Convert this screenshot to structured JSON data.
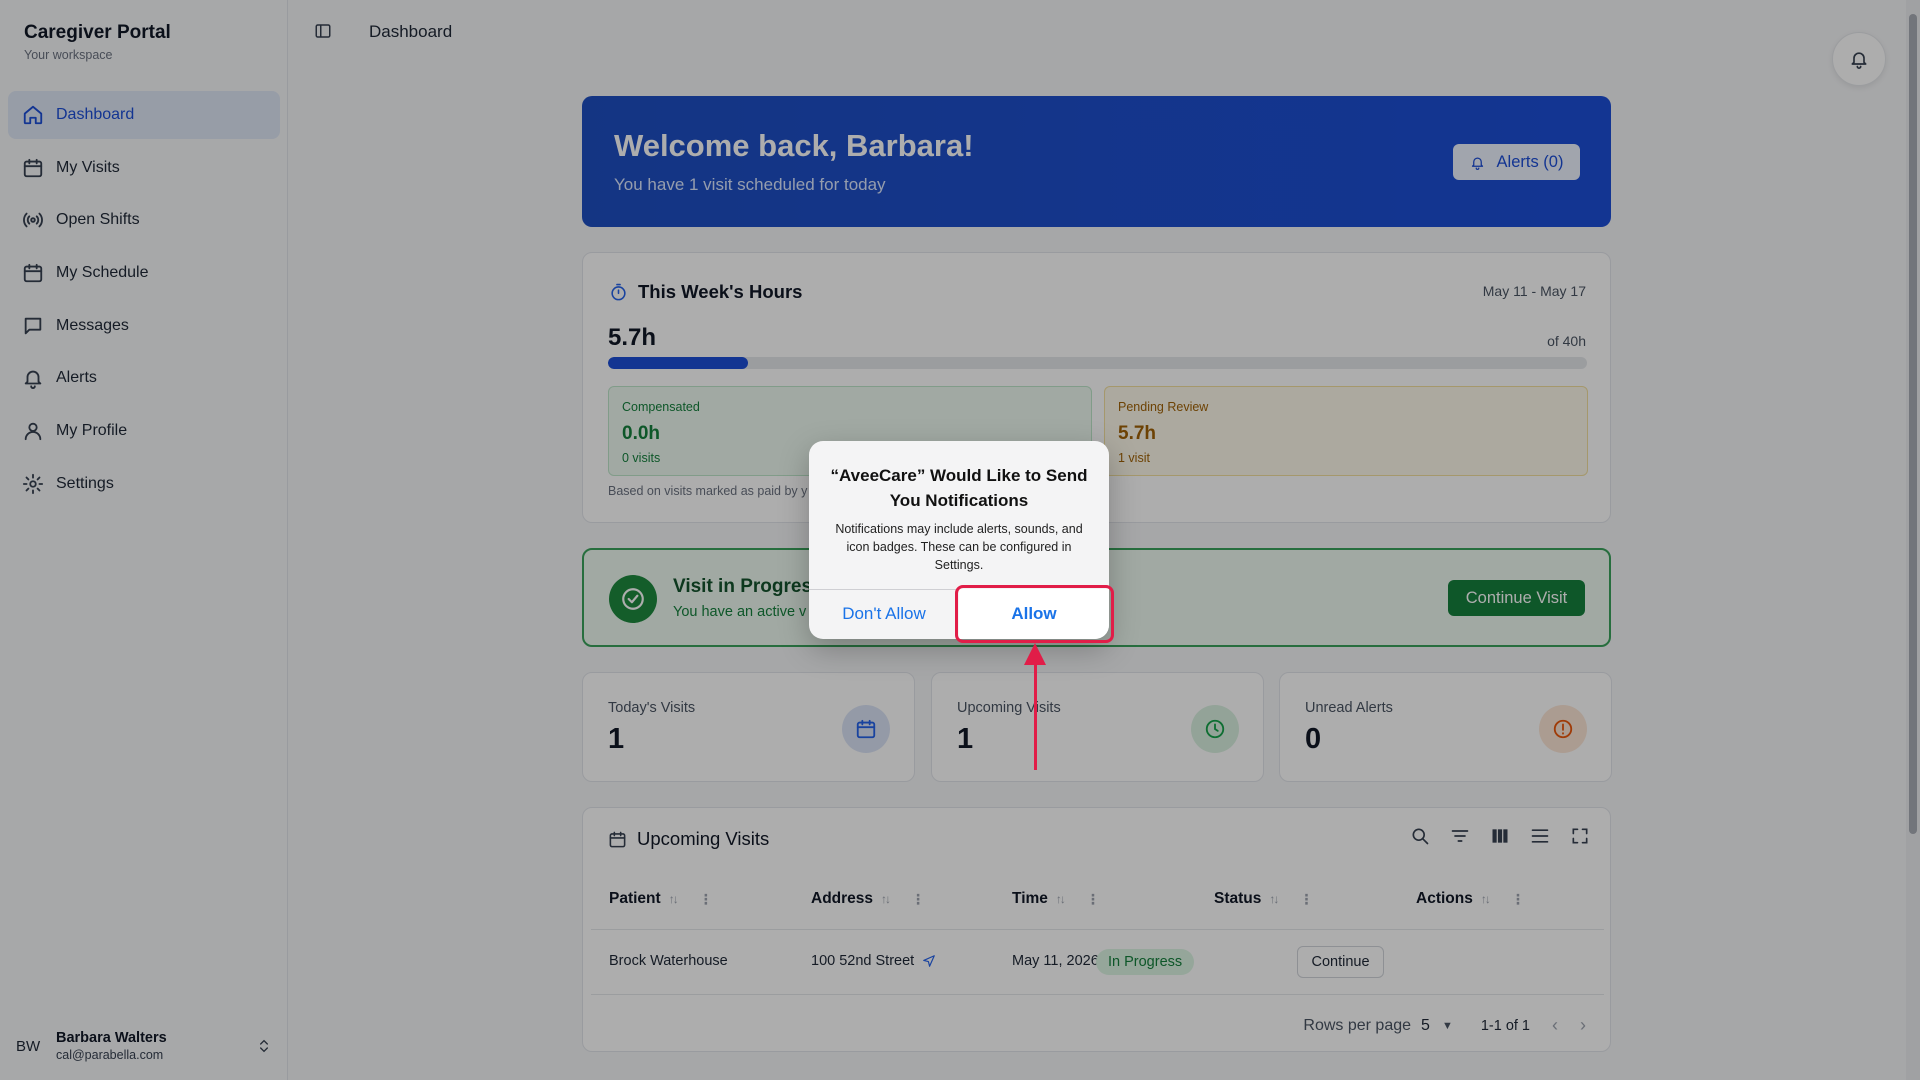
{
  "brand": {
    "title": "Caregiver Portal",
    "subtitle": "Your workspace"
  },
  "sidebar": {
    "items": [
      {
        "label": "Dashboard",
        "icon": "home-icon",
        "active": true
      },
      {
        "label": "My Visits",
        "icon": "calendar-icon"
      },
      {
        "label": "Open Shifts",
        "icon": "broadcast-icon"
      },
      {
        "label": "My Schedule",
        "icon": "calendar-icon"
      },
      {
        "label": "Messages",
        "icon": "message-icon"
      },
      {
        "label": "Alerts",
        "icon": "bell-icon"
      },
      {
        "label": "My Profile",
        "icon": "user-icon"
      },
      {
        "label": "Settings",
        "icon": "gear-icon"
      }
    ]
  },
  "user": {
    "initials": "BW",
    "name": "Barbara Walters",
    "email": "cal@parabella.com"
  },
  "topbar": {
    "title": "Dashboard"
  },
  "hero": {
    "title": "Welcome back, Barbara!",
    "subtitle": "You have 1 visit scheduled for today",
    "alerts_label": "Alerts (0)"
  },
  "hours": {
    "title": "This Week's Hours",
    "range": "May 11 - May 17",
    "value": "5.7h",
    "of": "of 40h",
    "progress_fraction": 0.1425,
    "compensated": {
      "label": "Compensated",
      "value": "0.0h",
      "count": "0 visits"
    },
    "pending": {
      "label": "Pending Review",
      "value": "5.7h",
      "count": "1 visit"
    },
    "note": "Based on visits marked as paid by y"
  },
  "visit_progress": {
    "title": "Visit in Progress",
    "subtitle": "You have an active v",
    "button": "Continue Visit"
  },
  "stats": [
    {
      "label": "Today's Visits",
      "value": "1",
      "icon": "calendar-icon",
      "color": "#2563eb"
    },
    {
      "label": "Upcoming Visits",
      "value": "1",
      "icon": "clock-icon",
      "color": "#16a34a"
    },
    {
      "label": "Unread Alerts",
      "value": "0",
      "icon": "alert-circle-icon",
      "color": "#ea580c"
    }
  ],
  "upcoming": {
    "title": "Upcoming Visits",
    "columns": [
      "Patient",
      "Address",
      "Time",
      "Status",
      "Actions"
    ],
    "rows": [
      {
        "patient": "Brock Waterhouse",
        "address": "100 52nd Street",
        "time": "May 11, 2026 • 1:00 AM",
        "status": "In Progress",
        "action": "Continue"
      }
    ],
    "pager": {
      "rows_label": "Rows per page",
      "rows_value": "5",
      "count": "1-1 of 1"
    }
  },
  "dialog": {
    "title": "“AveeCare” Would Like to Send You Notifications",
    "body": "Notifications may include alerts, sounds, and icon badges. These can be configured in Settings.",
    "deny": "Don't Allow",
    "allow": "Allow"
  },
  "colors": {
    "primary": "#1d4ed8",
    "success": "#15803d",
    "annotation": "#e11d48"
  }
}
